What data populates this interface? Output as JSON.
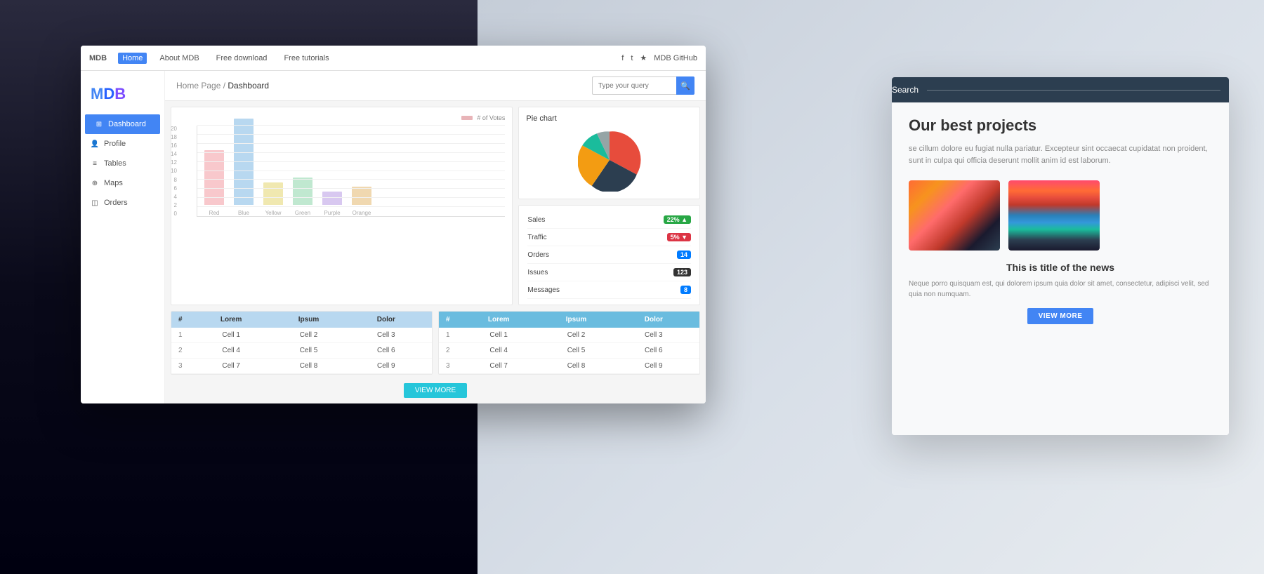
{
  "background": {
    "left_gradient": "#0a0a1a",
    "right_gradient": "#dce3ec"
  },
  "mdb_window": {
    "topnav": {
      "brand": "MDB",
      "nav_items": [
        "Home",
        "About MDB",
        "Free download",
        "Free tutorials"
      ],
      "active_nav": "Home",
      "social_items": [
        "f",
        "t",
        "★",
        "MDB GitHub"
      ]
    },
    "sidebar": {
      "logo": "MDB",
      "items": [
        {
          "label": "Dashboard",
          "icon": "grid",
          "active": true
        },
        {
          "label": "Profile",
          "icon": "user",
          "active": false
        },
        {
          "label": "Tables",
          "icon": "table",
          "active": false
        },
        {
          "label": "Maps",
          "icon": "map",
          "active": false
        },
        {
          "label": "Orders",
          "icon": "box",
          "active": false
        }
      ]
    },
    "content": {
      "breadcrumb_home": "Home Page",
      "breadcrumb_current": "Dashboard",
      "search_placeholder": "Type your query",
      "bar_chart": {
        "legend_label": "# of Votes",
        "y_axis": [
          "20",
          "18",
          "16",
          "14",
          "12",
          "10",
          "8",
          "6",
          "4",
          "2",
          "0"
        ],
        "bars": [
          {
            "label": "Red",
            "value": 12,
            "color": "bar-red"
          },
          {
            "label": "Blue",
            "value": 19,
            "color": "bar-blue"
          },
          {
            "label": "Yellow",
            "value": 5,
            "color": "bar-yellow"
          },
          {
            "label": "Green",
            "value": 6,
            "color": "bar-green"
          },
          {
            "label": "Purple",
            "value": 3,
            "color": "bar-purple"
          },
          {
            "label": "Orange",
            "value": 4,
            "color": "bar-orange"
          }
        ]
      },
      "pie_chart": {
        "title": "Pie chart",
        "segments": [
          {
            "label": "Red",
            "value": 30,
            "color": "#e74c3c"
          },
          {
            "label": "Blue",
            "value": 25,
            "color": "#2c3e50"
          },
          {
            "label": "Yellow",
            "value": 20,
            "color": "#f39c12"
          },
          {
            "label": "Green",
            "value": 15,
            "color": "#1abc9c"
          },
          {
            "label": "Purple",
            "value": 10,
            "color": "#95a5a6"
          }
        ]
      },
      "stats": [
        {
          "label": "Sales",
          "value": "22%",
          "badge_type": "green",
          "arrow": "▲"
        },
        {
          "label": "Traffic",
          "value": "5%",
          "badge_type": "red",
          "arrow": "▼"
        },
        {
          "label": "Orders",
          "value": "14",
          "badge_type": "blue",
          "arrow": ""
        },
        {
          "label": "Issues",
          "value": "123",
          "badge_type": "dark",
          "arrow": ""
        },
        {
          "label": "Messages",
          "value": "8",
          "badge_type": "blue",
          "arrow": ""
        }
      ],
      "tables": [
        {
          "headers": [
            "#",
            "Lorem",
            "Ipsum",
            "Dolor"
          ],
          "rows": [
            [
              "1",
              "Cell 1",
              "Cell 2",
              "Cell 3"
            ],
            [
              "2",
              "Cell 4",
              "Cell 5",
              "Cell 6"
            ],
            [
              "3",
              "Cell 7",
              "Cell 8",
              "Cell 9"
            ]
          ]
        },
        {
          "headers": [
            "#",
            "Lorem",
            "Ipsum",
            "Dolor"
          ],
          "rows": [
            [
              "1",
              "Cell 1",
              "Cell 2",
              "Cell 3"
            ],
            [
              "2",
              "Cell 4",
              "Cell 5",
              "Cell 6"
            ],
            [
              "3",
              "Cell 7",
              "Cell 8",
              "Cell 9"
            ]
          ]
        }
      ],
      "view_more_btn": "VIEW MORE"
    }
  },
  "news_window": {
    "topbar_label": "Search",
    "title": "Our best projects",
    "body_text": "se cillum dolore eu fugiat nulla pariatur. Excepteur sint occaecat cupidatat non proident, sunt in culpa qui officia deserunt mollit anim id est laborum.",
    "article": {
      "title": "This is title of the news",
      "body": "Neque porro quisquam est, qui dolorem ipsum quia dolor sit amet, consectetur, adipisci velit, sed quia non numquam.",
      "view_more": "VIEW MORE"
    },
    "img1_alt": "sunset photo",
    "img2_alt": "mountain lake photo"
  }
}
